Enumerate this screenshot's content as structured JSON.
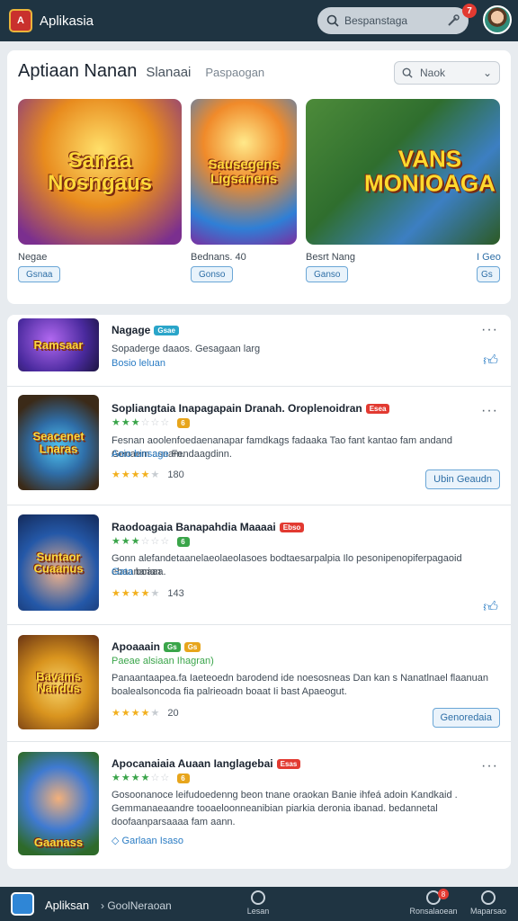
{
  "topbar": {
    "app_name": "Aplikasia",
    "search_placeholder": "Bespanstaga",
    "notification_count": "7"
  },
  "featured": {
    "title": "Aptiaan Nanan",
    "subtitle": "Slanaai",
    "tag": "Paspaogan",
    "search_placeholder": "Naok",
    "tiles": [
      {
        "art": "Sanaa Nosngaus",
        "name": "Negae",
        "button": "Gsnaa",
        "bg": "#d97a1e"
      },
      {
        "art": "Sausegens Ligsanens",
        "name": "Bednans.   40",
        "button": "Gonso",
        "bg": "#3c8ad6"
      },
      {
        "art": "VANS MONIOAGA",
        "name": "Besrt Nang",
        "button": "Ganso",
        "bg": "#3b7f3a"
      },
      {
        "name": "I Geo",
        "button": "Gs"
      }
    ]
  },
  "list": [
    {
      "title": "Nagage",
      "badge": "Gsae",
      "desc": "Sopaderge daaos. Gesagaan larg",
      "link": "Bosio leluan",
      "art": "Ramsaar",
      "bg": "#5b2d9e"
    },
    {
      "title": "Sopliangtaia Inapagapain Dranah. Oroplenoidran",
      "badge": "Esea",
      "stars_green": "★★★",
      "stars_off": "☆☆☆",
      "mini_badge": "6",
      "desc": "Fesnan aoolenfoedaenanapar famdkags fadaaka Tao fant kantao fam andand Genaem asnam.",
      "link": "Aoio binsage",
      "desc_tail": "Fendaagdinn.",
      "rating": "180",
      "button": "Ubin Geaudn",
      "art": "Seacenet Lnaras",
      "bg": "#2f6ea8"
    },
    {
      "title": "Raodoagaia Banapahdia Maaaai",
      "badge": "Ebso",
      "stars_green": "★★★",
      "stars_off": "☆☆☆",
      "mini_badge": "6",
      "desc": "Gonn alefandetaanelaeolaeolasoes bodtaesarpalpia Ilo pesonipenopiferpagaoid ebaanarian",
      "link": "Gata",
      "desc_tail": "boaaa.",
      "rating": "143",
      "art": "Suntaor Cuaanus",
      "bg": "#2458a8"
    },
    {
      "title": "Apoaaain",
      "badge": "Gs",
      "badge2": "Gs",
      "green_text": "Paeae alsiaan Ihagran)",
      "desc": "Panaantaapea.fa Iaeteoedn barodend ide noesosneas Dan kan s Nanatlnael flaanuan boalealsoncoda fia palrieoadn boaat Ii bast Apaeogut.",
      "rating": "20",
      "button": "Genoredaia",
      "art": "Bavams Nandus",
      "bg": "#d9941e"
    },
    {
      "title": "Apocanaiaia Auaan Ianglagebai",
      "badge": "Esas",
      "stars_green": "★★★★",
      "stars_off": "☆☆",
      "mini_badge": "6",
      "desc": "Gosoonanoce leifudoedenng beon tnane oraokan Banie ihfeá adoin Kandkaid . Gemmanaeaandre tooaeloonneanibian piarkia deronia ibanad. bedannetal doofaanparsaaaa fam aann.",
      "link": "Garlaan  Isaso",
      "art": "Gaanass",
      "bg": "#3f7ad1"
    }
  ],
  "bottombar": {
    "app_name": "Apliksan",
    "breadcrumb": "GoolNeraoan",
    "items": [
      {
        "label": "Lesan"
      },
      {
        "label": "Ronsalaoean",
        "badge": "8"
      },
      {
        "label": "Maparsao"
      }
    ]
  },
  "colors": {
    "topbar": "#1f3442",
    "accent": "#2a7cc4",
    "star": "#f2b01e",
    "badge_red": "#e23a31"
  }
}
